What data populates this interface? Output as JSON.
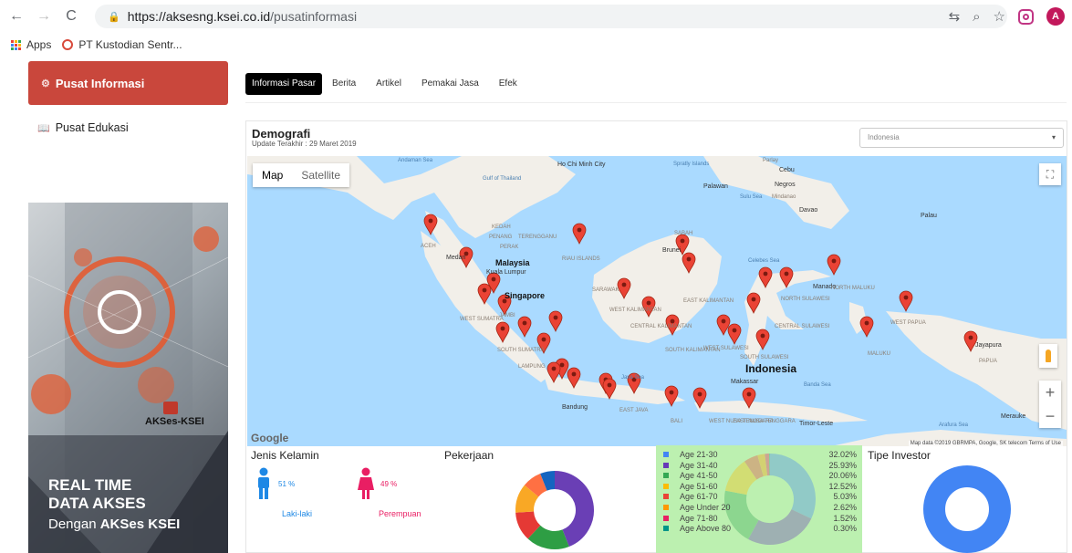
{
  "browser": {
    "url_host": "https://aksesng.ksei.co.id",
    "url_path": "/pusatinformasi",
    "bookmarks": [
      {
        "label": "Apps"
      },
      {
        "label": "PT Kustodian Sentr..."
      }
    ],
    "avatar_letter": "A"
  },
  "sidebar": {
    "items": [
      {
        "label": "Pusat Informasi",
        "active": true
      },
      {
        "label": "Pusat Edukasi",
        "active": false
      }
    ]
  },
  "banner": {
    "logo_text": "AKSes-KSEI",
    "line1": "REAL TIME",
    "line2": "DATA AKSES",
    "line3_prefix": "Dengan",
    "line3_brand": "AKSes KSEI"
  },
  "tabs": [
    {
      "label": "Informasi Pasar",
      "active": true
    },
    {
      "label": "Berita",
      "active": false
    },
    {
      "label": "Artikel",
      "active": false
    },
    {
      "label": "Pemakai Jasa",
      "active": false
    },
    {
      "label": "Efek",
      "active": false
    }
  ],
  "demografi": {
    "title": "Demografi",
    "updated": "Update Terakhir : 29 Maret 2019",
    "country_select": "Indonesia"
  },
  "map": {
    "mode_map": "Map",
    "mode_satellite": "Satellite",
    "google": "Google",
    "attribution": "Map data ©2019 GBRMPA, Google, SK telecom   Terms of Use",
    "labels": [
      {
        "text": "Andaman Sea"
      },
      {
        "text": "Ho Chi Minh City"
      },
      {
        "text": "Spratly Islands"
      },
      {
        "text": "Parlay"
      },
      {
        "text": "Cebu"
      },
      {
        "text": "Gulf of Thailand"
      },
      {
        "text": "Palawan"
      },
      {
        "text": "Negros"
      },
      {
        "text": "Sulu Sea"
      },
      {
        "text": "Mindanao"
      },
      {
        "text": "Davao"
      },
      {
        "text": "Palau"
      },
      {
        "text": "KEDAH"
      },
      {
        "text": "PENANG"
      },
      {
        "text": "TERENGGANU"
      },
      {
        "text": "PERAK"
      },
      {
        "text": "SABAH"
      },
      {
        "text": "Brunei"
      },
      {
        "text": "ACEH"
      },
      {
        "text": "Medan"
      },
      {
        "text": "Malaysia"
      },
      {
        "text": "Kuala Lumpur"
      },
      {
        "text": "RIAU ISLANDS"
      },
      {
        "text": "Celebes Sea"
      },
      {
        "text": "Singapore"
      },
      {
        "text": "SARAWAK"
      },
      {
        "text": "EAST KALIMANTAN"
      },
      {
        "text": "Manado"
      },
      {
        "text": "NORTH SULAWESI"
      },
      {
        "text": "NORTH MALUKU"
      },
      {
        "text": "WEST KALIMANTAN"
      },
      {
        "text": "CENTRAL KALIMANTAN"
      },
      {
        "text": "WEST SUMATRA"
      },
      {
        "text": "JAMBI"
      },
      {
        "text": "SOUTH SUMATRA"
      },
      {
        "text": "CENTRAL SULAWESI"
      },
      {
        "text": "WEST PAPUA"
      },
      {
        "text": "SOUTH KALIMANTAN"
      },
      {
        "text": "WEST SULAWESI"
      },
      {
        "text": "SOUTH SULAWESI"
      },
      {
        "text": "MALUKU"
      },
      {
        "text": "Jayapura"
      },
      {
        "text": "PAPUA"
      },
      {
        "text": "Indonesia"
      },
      {
        "text": "LAMPUNG"
      },
      {
        "text": "Java Sea"
      },
      {
        "text": "Makassar"
      },
      {
        "text": "Banda Sea"
      },
      {
        "text": "Bandung"
      },
      {
        "text": "EAST JAVA"
      },
      {
        "text": "BALI"
      },
      {
        "text": "WEST NUSA TENGGARA"
      },
      {
        "text": "EAST NUSA TENGGARA"
      },
      {
        "text": "Timor-Leste"
      },
      {
        "text": "Arafura Sea"
      },
      {
        "text": "Merauke"
      }
    ],
    "marker_count": 34
  },
  "gender": {
    "title": "Jenis Kelamin",
    "male_pct": "51 %",
    "female_pct": "49 %",
    "male_label": "Laki-laki",
    "female_label": "Perempuan",
    "male_color": "#1e88e5",
    "female_color": "#e91e63"
  },
  "pekerjaan": {
    "title": "Pekerjaan",
    "segments": [
      {
        "value": 0.44,
        "color": "#6a3fb5"
      },
      {
        "value": 0.18,
        "color": "#2e9e44"
      },
      {
        "value": 0.12,
        "color": "#e53935"
      },
      {
        "value": 0.12,
        "color": "#f9a825"
      },
      {
        "value": 0.08,
        "color": "#ff7043"
      },
      {
        "value": 0.06,
        "color": "#1565c0"
      }
    ]
  },
  "age": {
    "rows": [
      {
        "label": "Age 21-30",
        "pct": "32.02%",
        "value": 32.02,
        "color": "#4285f4"
      },
      {
        "label": "Age 31-40",
        "pct": "25.93%",
        "value": 25.93,
        "color": "#673ab7"
      },
      {
        "label": "Age 41-50",
        "pct": "20.06%",
        "value": 20.06,
        "color": "#34a853"
      },
      {
        "label": "Age 51-60",
        "pct": "12.52%",
        "value": 12.52,
        "color": "#fbbc05"
      },
      {
        "label": "Age 61-70",
        "pct": "5.03%",
        "value": 5.03,
        "color": "#ea4335"
      },
      {
        "label": "Age Under 20",
        "pct": "2.62%",
        "value": 2.62,
        "color": "#ff9800"
      },
      {
        "label": "Age 71-80",
        "pct": "1.52%",
        "value": 1.52,
        "color": "#e91e63"
      },
      {
        "label": "Age Above 80",
        "pct": "0.30%",
        "value": 0.3,
        "color": "#009688"
      }
    ]
  },
  "tipe_investor": {
    "title": "Tipe Investor",
    "color": "#4285f4"
  }
}
